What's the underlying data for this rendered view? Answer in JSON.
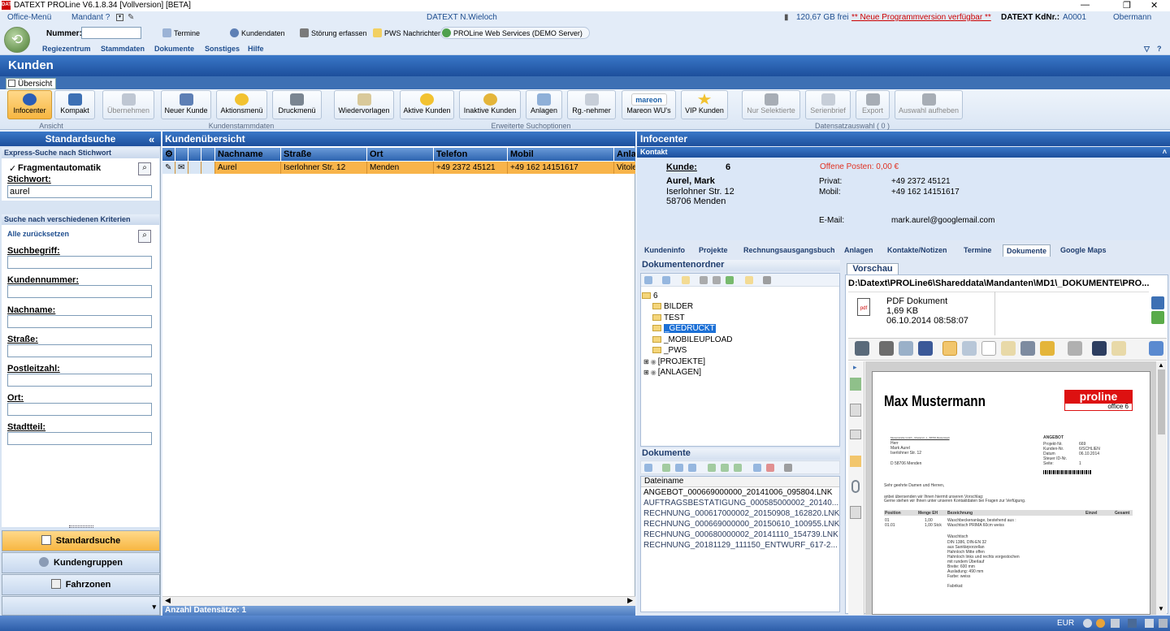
{
  "app": {
    "title": "DATEXT PROLine V6.1.8.34 [Vollversion]  [BETA]",
    "logo": "DATEXT"
  },
  "topbar": {
    "office_menu": "Office-Menü",
    "mandant": "Mandant ?",
    "center": "DATEXT N.Wieloch",
    "disk": "120,67 GB frei",
    "update": "** Neue Programmversion verfügbar **",
    "kd_label": "DATEXT KdNr.:",
    "kd_value": "A0001",
    "user": "Obermann"
  },
  "nav": {
    "nummer_label": "Nummer:",
    "nummer_value": "",
    "tools": [
      "Termine",
      "Kundendaten",
      "Störung erfassen",
      "PWS Nachrichten",
      "PROLine Web Services (DEMO Server)"
    ],
    "menu": [
      "Regiezentrum",
      "Stammdaten",
      "Dokumente",
      "Sonstiges",
      "Hilfe"
    ]
  },
  "page": {
    "title": "Kunden",
    "tab": "Übersicht"
  },
  "ribbon": {
    "buttons": [
      "Infocenter",
      "Kompakt",
      "Übernehmen",
      "Neuer Kunde",
      "Aktionsmenü",
      "Druckmenü",
      "Wiedervorlagen",
      "Aktive Kunden",
      "Inaktive Kunden",
      "Anlagen",
      "Rg.-nehmer",
      "Mareon WU's",
      "VIP Kunden",
      "Nur Selektierte",
      "Serienbrief",
      "Export",
      "Auswahl aufheben"
    ],
    "groups": [
      "Ansicht",
      "Kundenstammdaten",
      "Erweiterte Suchoptionen",
      "Datensatzauswahl ( 0 )"
    ],
    "mareon_logo": "mareon"
  },
  "left": {
    "title": "Standardsuche",
    "express": "Express-Suche nach Stichwort",
    "fragment": "Fragmentautomatik",
    "stichwort_label": "Stichwort:",
    "stichwort_value": "aurel",
    "criteria": "Suche nach verschiedenen Kriterien",
    "reset": "Alle zurücksetzen",
    "fields": [
      {
        "label": "Suchbegriff:",
        "value": ""
      },
      {
        "label": "Kundennummer:",
        "value": ""
      },
      {
        "label": "Nachname:",
        "value": ""
      },
      {
        "label": "Straße:",
        "value": ""
      },
      {
        "label": "Postleitzahl:",
        "value": ""
      },
      {
        "label": "Ort:",
        "value": ""
      },
      {
        "label": "Stadtteil:",
        "value": ""
      }
    ],
    "nav": [
      "Standardsuche",
      "Kundengruppen",
      "Fahrzonen"
    ],
    "collapse": "«"
  },
  "mid": {
    "title": "Kundenübersicht",
    "columns": [
      "Nachname",
      "Straße",
      "Ort",
      "Telefon",
      "Mobil",
      "Anlag"
    ],
    "rows": [
      {
        "nachname": "Aurel",
        "strasse": "Iserlohner Str. 12",
        "ort": "Menden",
        "telefon": "+49 2372 45121",
        "mobil": "+49 162 14151617",
        "anlagen": "Vitole"
      }
    ],
    "count": "Anzahl Datensätze: 1"
  },
  "right": {
    "title": "Infocenter",
    "kontakt": "Kontakt",
    "kunde_label": "Kunde:",
    "kunde_nr": "6",
    "offene": "Offene Posten: 0,00 €",
    "name": "Aurel, Mark",
    "street": "Iserlohner Str. 12",
    "city": "58706 Menden",
    "privat_label": "Privat:",
    "privat": "+49 2372 45121",
    "mobil_label": "Mobil:",
    "mobil": "+49 162 14151617",
    "email_label": "E-Mail:",
    "email": "mark.aurel@googlemail.com",
    "tabs": [
      "Kundeninfo",
      "Projekte",
      "Rechnungsausgangsbuch",
      "Anlagen",
      "Kontakte/Notizen",
      "Termine",
      "Dokumente",
      "Google Maps"
    ],
    "docfolder": "Dokumentenordner",
    "tree": [
      "6",
      "BILDER",
      "TEST",
      "_GEDRUCKT",
      "_MOBILEUPLOAD",
      "_PWS",
      "[PROJEKTE]",
      "[ANLAGEN]"
    ],
    "docs_title": "Dokumente",
    "docs_col": "Dateiname",
    "docs": [
      "ANGEBOT_000669000000_20141006_095804.LNK",
      "AUFTRAGSBESTÄTIGUNG_000585000002_20140...",
      "RECHNUNG_000617000002_20150908_162820.LNK",
      "RECHNUNG_000669000000_20150610_100955.LNK",
      "RECHNUNG_000680000002_20141110_154739.LNK",
      "RECHNUNG_20181129_111150_ENTWURF_617-2..."
    ],
    "preview_tab": "Vorschau",
    "path": "D:\\Datext\\PROLine6\\Shareddata\\Mandanten\\MD1\\_DOKUMENTE\\PRO...",
    "file_type": "PDF Dokument",
    "file_size": "1,69 KB",
    "file_date": "06.10.2014 08:58:07",
    "pdf": {
      "name": "Max Mustermann",
      "logo": "proline",
      "logo_sub": "office 6",
      "doc": "ANGEBOT",
      "sender": "Musterstraße Gmbh · Musterstr. 1 · 58706 Musterstadt",
      "addr": [
        "Herr",
        "Mark Aurel",
        "Iserlohner Str. 12",
        "",
        "D 58706 Menden"
      ],
      "meta": [
        [
          "Projekt-Nr.",
          "669"
        ],
        [
          "Kunden-Nr.",
          "6/SCHLIEN"
        ],
        [
          "Datum",
          "06.10.2014"
        ],
        [
          "Steuer ID-Nr.",
          ""
        ],
        [
          "Seite:",
          "1"
        ]
      ],
      "greet": "Sehr geehrte Damen und Herren,",
      "intro1": "anbei übersenden wir Ihnen hiermit unseren Vorschlag:",
      "intro2": "Gerne stehen wir Ihnen unter unseren Kontaktdaten bei Fragen zur Verfügung.",
      "cols": [
        "Position",
        "Menge EH",
        "Bezeichnung",
        "Einzel",
        "Gesamt"
      ],
      "lines": [
        [
          "01",
          "1,00",
          "Waschbeckenanlage, bestehend aus :"
        ],
        [
          "01.01",
          "1,00 Stck",
          "Waschtisch PRIMA 60cm weiss"
        ]
      ],
      "desc": [
        "Waschtisch",
        "DIN 1386, DIN-EN 32",
        "aus Sanitärporzellan",
        "Hahnloch Mitte offen",
        "Hahnloch links und rechts vorgestochen",
        "mit rundem Überlauf",
        "Breite: 600 mm",
        "Ausladung: 490 mm",
        "Farbe: weiss",
        "",
        "Fabrikat:"
      ]
    }
  },
  "status": {
    "currency": "EUR"
  }
}
